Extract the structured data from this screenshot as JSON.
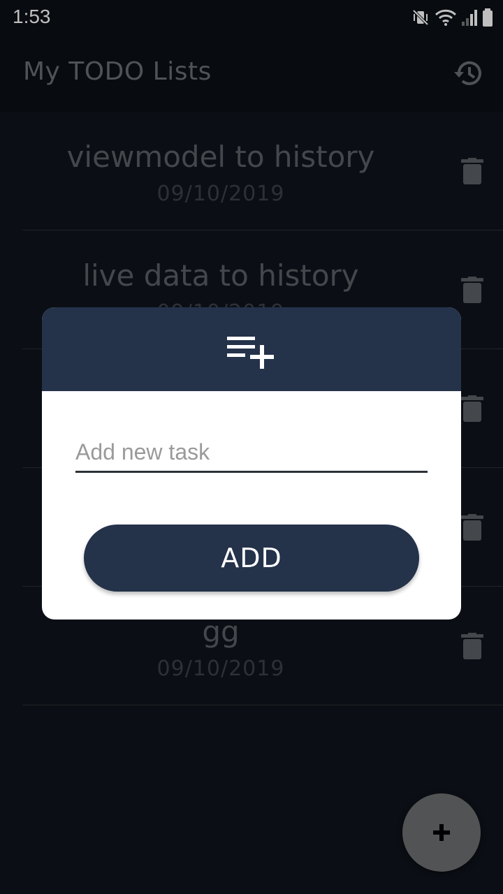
{
  "status_bar": {
    "time": "1:53"
  },
  "app_bar": {
    "title": "My TODO Lists",
    "history_icon": "history-icon"
  },
  "lists": [
    {
      "title": "viewmodel to history",
      "date": "09/10/2019"
    },
    {
      "title": "live data to history",
      "date": "09/10/2019"
    },
    {
      "title": "",
      "date": ""
    },
    {
      "title": "",
      "date": ""
    },
    {
      "title": "gg",
      "date": "09/10/2019"
    }
  ],
  "dialog": {
    "header_icon": "playlist-add-icon",
    "input_placeholder": "Add new task",
    "input_value": "",
    "add_label": "ADD"
  },
  "fab": {
    "icon": "plus-icon"
  },
  "colors": {
    "primary": "#24324a",
    "background": "#0f141c",
    "fab": "#6e6f71"
  }
}
